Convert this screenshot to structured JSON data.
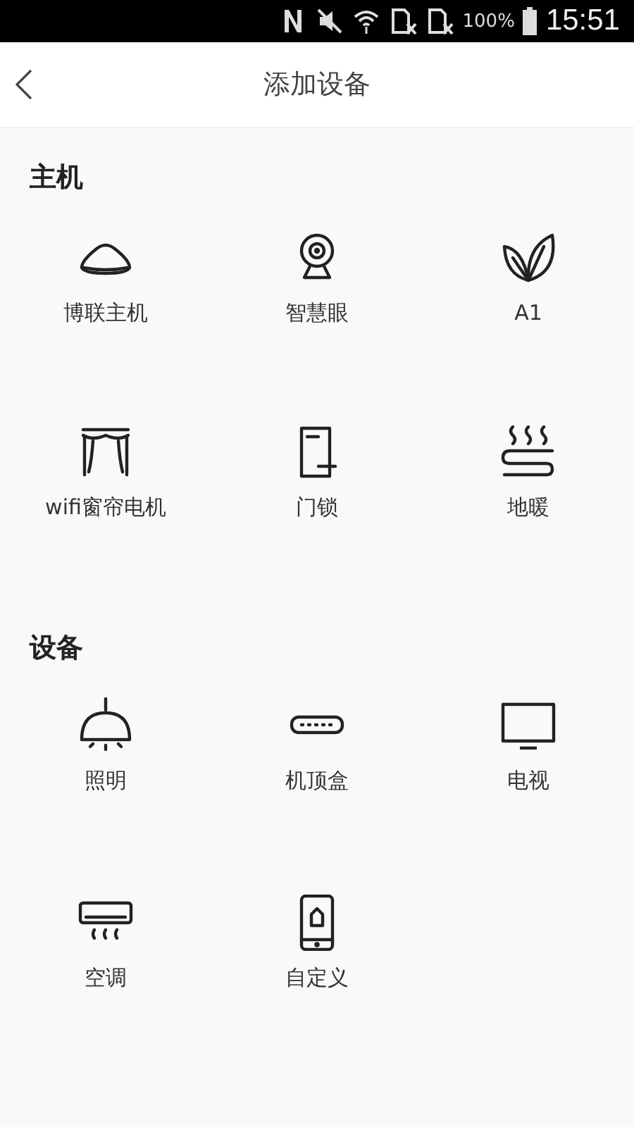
{
  "status_bar": {
    "battery": "100%",
    "time": "15:51"
  },
  "header": {
    "title": "添加设备"
  },
  "sections": [
    {
      "title": "主机",
      "items": [
        {
          "label": "博联主机",
          "kind": "hub"
        },
        {
          "label": "智慧眼",
          "kind": "camera"
        },
        {
          "label": "A1",
          "kind": "leaf"
        },
        {
          "label": "wifi窗帘电机",
          "kind": "curtain"
        },
        {
          "label": "门锁",
          "kind": "lock"
        },
        {
          "label": "地暖",
          "kind": "heating"
        }
      ]
    },
    {
      "title": "设备",
      "items": [
        {
          "label": "照明",
          "kind": "lamp"
        },
        {
          "label": "机顶盒",
          "kind": "settop"
        },
        {
          "label": "电视",
          "kind": "tv"
        },
        {
          "label": "空调",
          "kind": "aircon"
        },
        {
          "label": "自定义",
          "kind": "phone"
        }
      ]
    }
  ]
}
